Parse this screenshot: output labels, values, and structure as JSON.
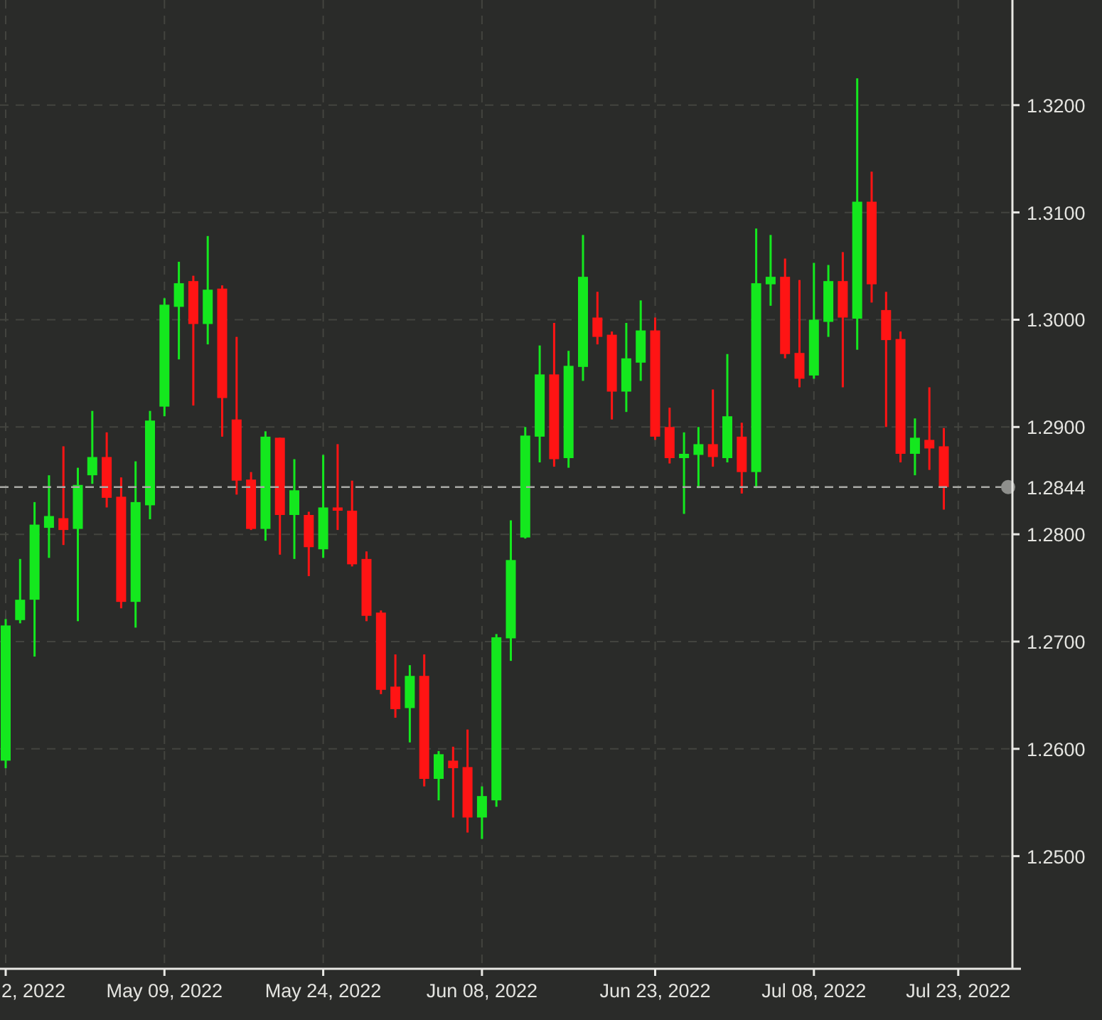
{
  "chart": {
    "chart_data": {
      "type": "candlestick",
      "grid": true,
      "categories": [
        null,
        null,
        null,
        null,
        null,
        null,
        null,
        null,
        null,
        null,
        null,
        "May 09, 2022",
        null,
        null,
        null,
        null,
        null,
        null,
        null,
        null,
        null,
        null,
        "May 24, 2022",
        null,
        null,
        null,
        null,
        null,
        null,
        null,
        null,
        null,
        null,
        "Jun 08, 2022",
        null,
        null,
        null,
        null,
        null,
        null,
        null,
        null,
        null,
        null,
        null,
        "Jun 23, 2022",
        null,
        null,
        null,
        null,
        null,
        null,
        null,
        null,
        null,
        null,
        "Jul 08, 2022",
        null,
        null,
        null,
        null,
        null,
        null,
        null,
        null,
        null,
        "Jul 23, 2022"
      ],
      "ohlc": [
        [
          1.2589,
          1.2721,
          1.2582,
          1.2715
        ],
        [
          1.272,
          1.2777,
          1.2717,
          1.2739
        ],
        [
          1.2739,
          1.283,
          1.2686,
          1.2809
        ],
        [
          1.2806,
          1.2855,
          1.2778,
          1.2817
        ],
        [
          1.2815,
          1.2882,
          1.279,
          1.2804
        ],
        [
          1.2805,
          1.2862,
          1.2719,
          1.2846
        ],
        [
          1.2855,
          1.2915,
          1.2847,
          1.2872
        ],
        [
          1.2872,
          1.2895,
          1.2825,
          1.2834
        ],
        [
          1.2835,
          1.2853,
          1.2731,
          1.2737
        ],
        [
          1.2737,
          1.2868,
          1.2713,
          1.283
        ],
        [
          1.2827,
          1.2915,
          1.2814,
          1.2906
        ],
        [
          1.2919,
          1.302,
          1.291,
          1.3014
        ],
        [
          1.3012,
          1.3054,
          1.2963,
          1.3034
        ],
        [
          1.3036,
          1.3041,
          1.292,
          1.2996
        ],
        [
          1.2996,
          1.3078,
          1.2977,
          1.3028
        ],
        [
          1.3029,
          1.3032,
          1.2891,
          1.2927
        ],
        [
          1.2907,
          1.2984,
          1.2837,
          1.285
        ],
        [
          1.2851,
          1.2858,
          1.2804,
          1.2805
        ],
        [
          1.2805,
          1.2896,
          1.2794,
          1.2891
        ],
        [
          1.289,
          1.289,
          1.2781,
          1.2818
        ],
        [
          1.2818,
          1.287,
          1.2777,
          1.2841
        ],
        [
          1.2818,
          1.2821,
          1.2761,
          1.2788
        ],
        [
          1.2786,
          1.2874,
          1.2778,
          1.2825
        ],
        [
          1.2825,
          1.2884,
          1.2804,
          1.2822
        ],
        [
          1.2822,
          1.285,
          1.277,
          1.2772
        ],
        [
          1.2777,
          1.2784,
          1.2719,
          1.2724
        ],
        [
          1.2727,
          1.2729,
          1.2651,
          1.2655
        ],
        [
          1.2658,
          1.2688,
          1.2629,
          1.2637
        ],
        [
          1.2638,
          1.2678,
          1.2606,
          1.2668
        ],
        [
          1.2668,
          1.2688,
          1.2565,
          1.2572
        ],
        [
          1.2572,
          1.2598,
          1.2552,
          1.2595
        ],
        [
          1.2589,
          1.2602,
          1.2536,
          1.2582
        ],
        [
          1.2583,
          1.2618,
          1.2522,
          1.2536
        ],
        [
          1.2536,
          1.2565,
          1.2516,
          1.2556
        ],
        [
          1.2552,
          1.2707,
          1.2546,
          1.2704
        ],
        [
          1.2703,
          1.2813,
          1.2682,
          1.2776
        ],
        [
          1.2797,
          1.29,
          1.2796,
          1.2892
        ],
        [
          1.2891,
          1.2976,
          1.2867,
          1.2949
        ],
        [
          1.2949,
          1.2997,
          1.2863,
          1.287
        ],
        [
          1.2871,
          1.2971,
          1.2862,
          1.2957
        ],
        [
          1.2956,
          1.3079,
          1.2943,
          1.304
        ],
        [
          1.3002,
          1.3026,
          1.2977,
          1.2984
        ],
        [
          1.2986,
          1.2989,
          1.2907,
          1.2933
        ],
        [
          1.2933,
          1.2997,
          1.2914,
          1.2964
        ],
        [
          1.296,
          1.3018,
          1.2943,
          1.299
        ],
        [
          1.299,
          1.3002,
          1.2888,
          1.2891
        ],
        [
          1.29,
          1.2918,
          1.2866,
          1.2871
        ],
        [
          1.2871,
          1.2895,
          1.2819,
          1.2875
        ],
        [
          1.2874,
          1.29,
          1.2843,
          1.2884
        ],
        [
          1.2884,
          1.2935,
          1.2863,
          1.2872
        ],
        [
          1.2871,
          1.2968,
          1.2867,
          1.291
        ],
        [
          1.2891,
          1.2904,
          1.2838,
          1.2858
        ],
        [
          1.2858,
          1.3085,
          1.2843,
          1.3034
        ],
        [
          1.3033,
          1.3079,
          1.3013,
          1.304
        ],
        [
          1.304,
          1.3057,
          1.2964,
          1.2968
        ],
        [
          1.2969,
          1.3037,
          1.2937,
          1.2945
        ],
        [
          1.2948,
          1.3053,
          1.2945,
          1.3
        ],
        [
          1.2998,
          1.3051,
          1.2984,
          1.3036
        ],
        [
          1.3036,
          1.3063,
          1.2937,
          1.3002
        ],
        [
          1.3001,
          1.3225,
          1.2972,
          1.311
        ],
        [
          1.311,
          1.3138,
          1.3016,
          1.3033
        ],
        [
          1.3009,
          1.3026,
          1.29,
          1.2981
        ],
        [
          1.2982,
          1.2989,
          1.2867,
          1.2875
        ],
        [
          1.2875,
          1.2908,
          1.2855,
          1.289
        ],
        [
          1.2888,
          1.2937,
          1.286,
          1.288
        ],
        [
          1.2882,
          1.2899,
          1.2823,
          1.2844
        ],
        null
      ],
      "ylim": [
        1.2395,
        1.3298
      ],
      "yticks": [
        {
          "value": 1.32,
          "label": "1.3200"
        },
        {
          "value": 1.31,
          "label": "1.3100"
        },
        {
          "value": 1.3,
          "label": "1.3000"
        },
        {
          "value": 1.29,
          "label": "1.2900"
        },
        {
          "value": 1.28,
          "label": "1.2800"
        },
        {
          "value": 1.27,
          "label": "1.2700"
        },
        {
          "value": 1.26,
          "label": "1.2600"
        },
        {
          "value": 1.25,
          "label": "1.2500"
        }
      ],
      "ref_lines": [
        {
          "axis": "y",
          "value": 1.2844,
          "label": "1.2844"
        }
      ]
    },
    "clipped_x_label": "2, 2022"
  }
}
